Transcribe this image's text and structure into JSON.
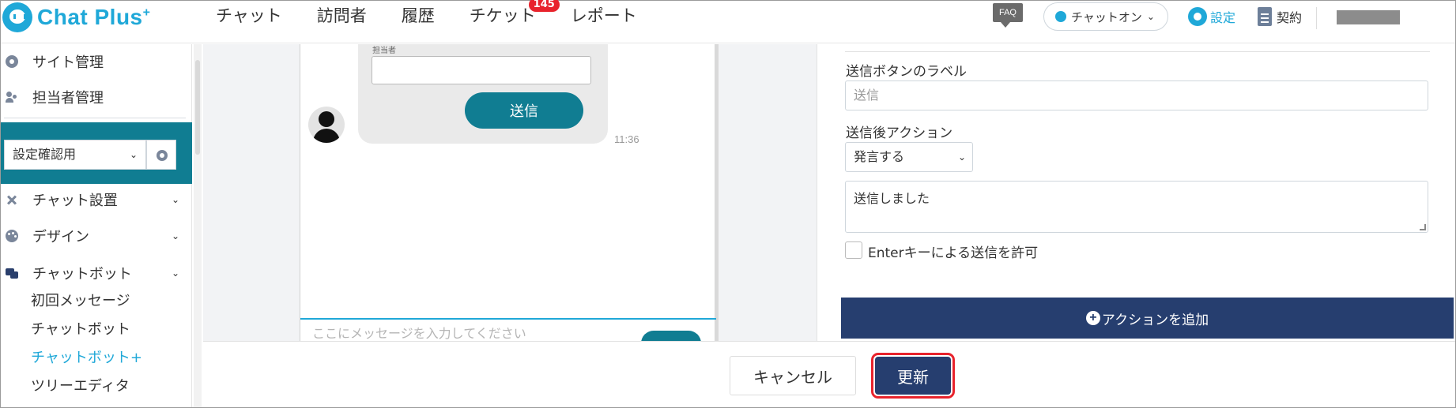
{
  "app": {
    "logo_text": "Chat Plus",
    "logo_sup": "+",
    "brand_color": "#1fa8d8"
  },
  "nav": {
    "items": [
      {
        "label": "チャット"
      },
      {
        "label": "訪問者"
      },
      {
        "label": "履歴"
      },
      {
        "label": "チケット",
        "badge": "145"
      },
      {
        "label": "レポート"
      }
    ]
  },
  "header_right": {
    "faq": "FAQ",
    "status": "チャットオン",
    "settings": "設定",
    "contract": "契約"
  },
  "sidebar": {
    "top_items": [
      {
        "label": "サイト管理",
        "icon": "gear-icon"
      },
      {
        "label": "担当者管理",
        "icon": "people-icon"
      }
    ],
    "site_select": "設定確認用",
    "menu_items": [
      {
        "label": "チャット設置",
        "icon": "tools-icon"
      },
      {
        "label": "デザイン",
        "icon": "palette-icon"
      },
      {
        "label": "チャットボット",
        "icon": "chat-icon"
      }
    ],
    "sub_items": [
      {
        "label": "初回メッセージ",
        "active": false
      },
      {
        "label": "チャットボット",
        "active": false
      },
      {
        "label": "チャットボット+",
        "active": true
      },
      {
        "label": "ツリーエディタ",
        "active": false
      }
    ]
  },
  "preview": {
    "field_label": "担当者",
    "send_button": "送信",
    "time": "11:36",
    "input_placeholder": "ここにメッセージを入力してください"
  },
  "form": {
    "send_label_title": "送信ボタンのラベル",
    "send_label_placeholder": "送信",
    "after_action_title": "送信後アクション",
    "after_action_value": "発言する",
    "message_value": "送信しました",
    "enter_checkbox_label": "Enterキーによる送信を許可",
    "add_action": "アクションを追加"
  },
  "footer": {
    "cancel": "キャンセル",
    "update": "更新"
  },
  "colors": {
    "teal": "#107d92",
    "navy": "#263e6f",
    "highlight": "#e8232c"
  }
}
